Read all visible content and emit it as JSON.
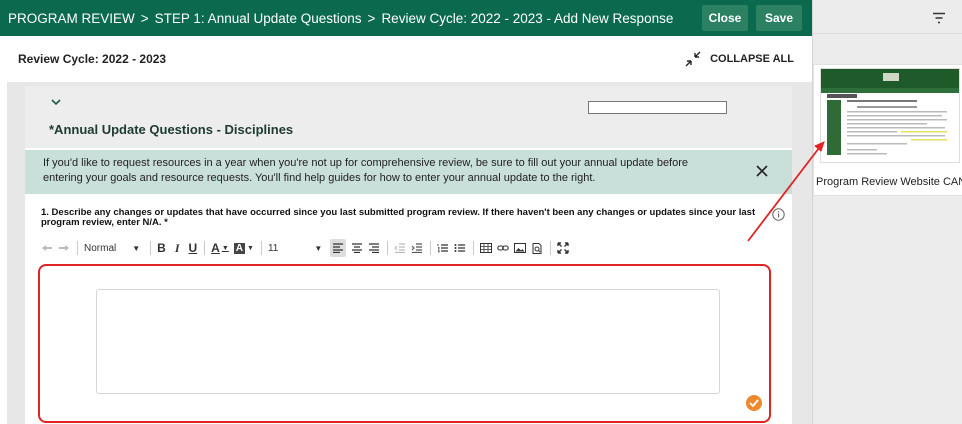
{
  "header": {
    "crumb1": "PROGRAM REVIEW",
    "crumb2": "STEP 1: Annual Update Questions",
    "crumb3": "Review Cycle: 2022 - 2023 - Add New Response",
    "separator": ">",
    "close_label": "Close",
    "save_label": "Save",
    "color": "#0b6a4e"
  },
  "cycle": {
    "title": "Review Cycle: 2022 - 2023",
    "collapse_label": "COLLAPSE ALL"
  },
  "section": {
    "title": "*Annual Update Questions - Disciplines",
    "banner_text": "If you'd like to request resources in a year when you're not up for comprehensive review, be sure to fill out your annual update before entering your goals and resource requests. You'll find help guides for how to enter your annual update to the right."
  },
  "question": {
    "text": "1. Describe any changes or updates that have occurred since you last submitted program review. If there haven't been any changes or updates since your last program review, enter N/A. *"
  },
  "toolbar": {
    "style_value": "Normal",
    "size_value": "11",
    "bold": "B",
    "italic": "I",
    "underline": "U",
    "font_color": "A",
    "bg_color": "A"
  },
  "right_panel": {
    "thumb_label": "Program Review Website CAN",
    "thumb_title": "Program Review"
  },
  "colors": {
    "highlight_border": "#e02424",
    "ok_badge": "#ec8a2d",
    "banner": "#c9dfd9"
  }
}
